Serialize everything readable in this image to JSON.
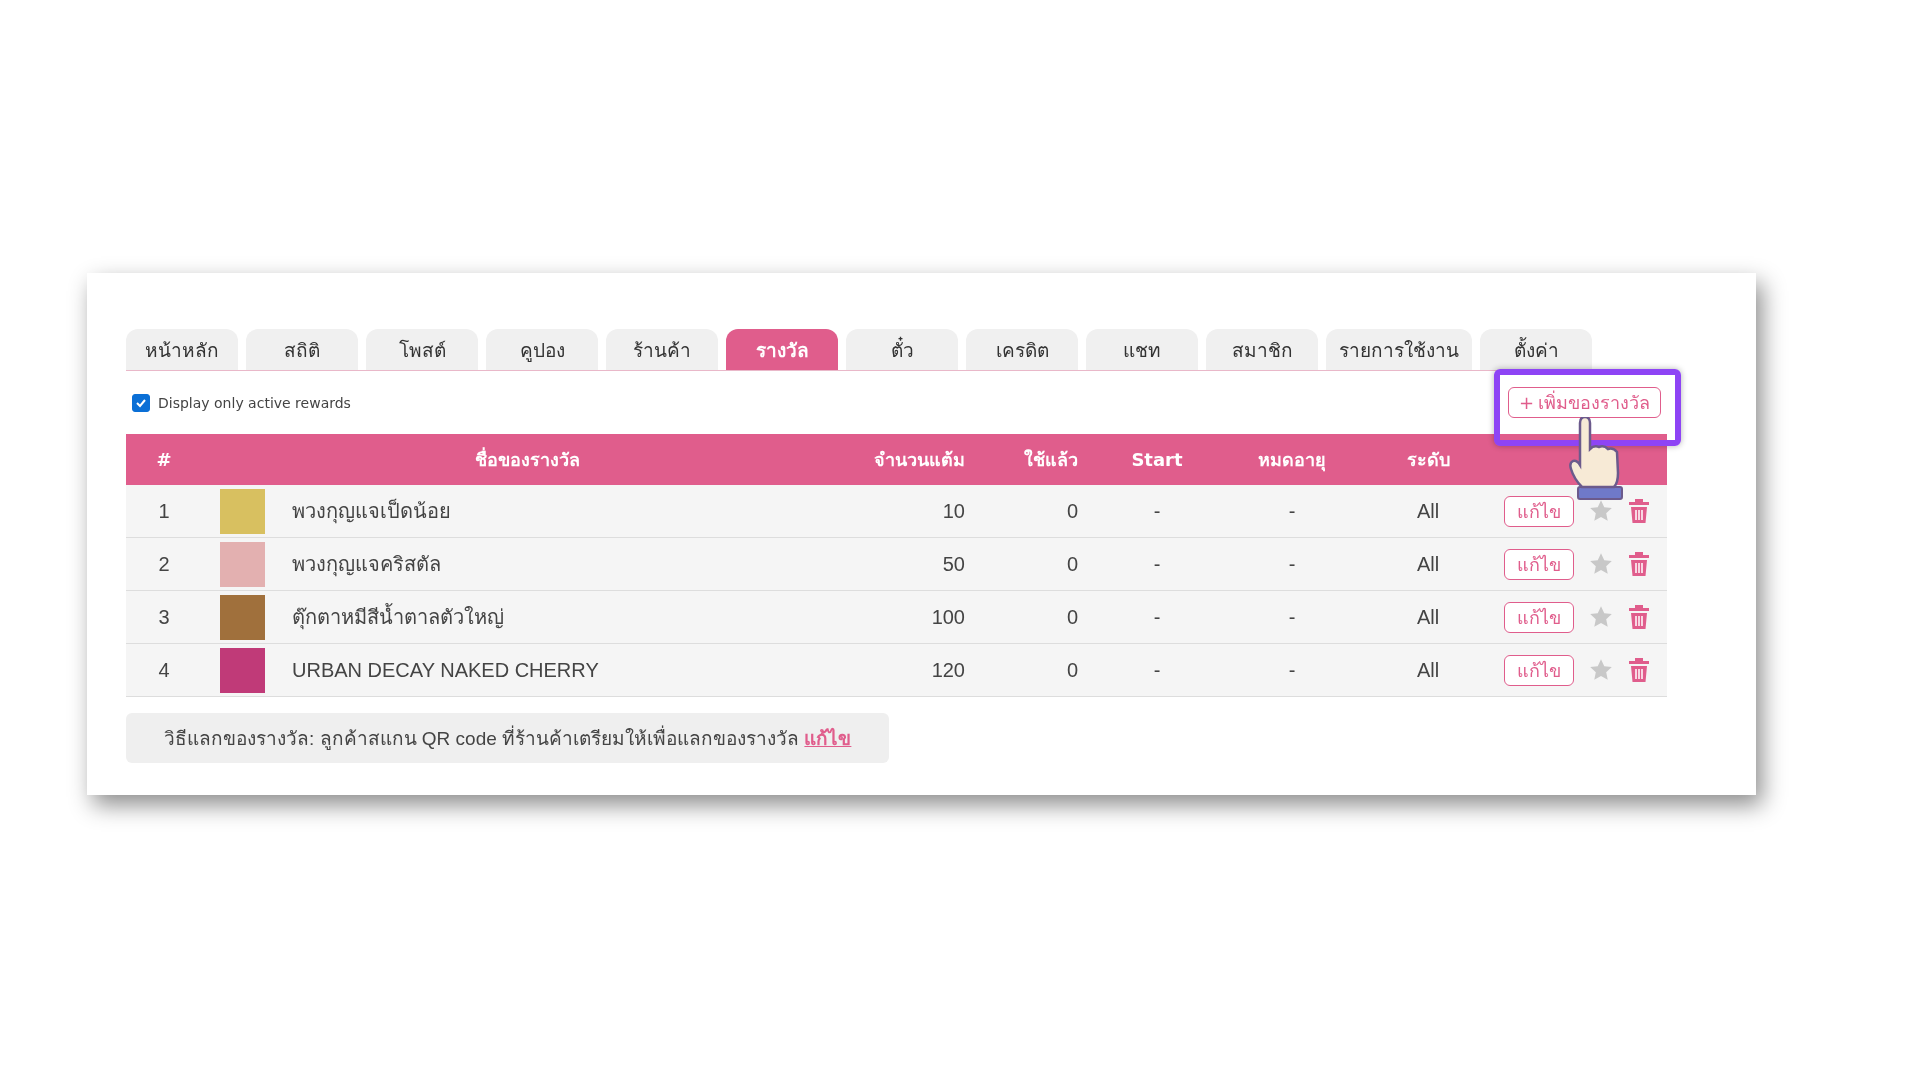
{
  "tabs": [
    {
      "label": "หน้าหลัก",
      "selected": false
    },
    {
      "label": "สถิติ",
      "selected": false
    },
    {
      "label": "โพสต์",
      "selected": false
    },
    {
      "label": "คูปอง",
      "selected": false
    },
    {
      "label": "ร้านค้า",
      "selected": false
    },
    {
      "label": "รางวัล",
      "selected": true
    },
    {
      "label": "ตั๋ว",
      "selected": false
    },
    {
      "label": "เครดิต",
      "selected": false
    },
    {
      "label": "แชท",
      "selected": false
    },
    {
      "label": "สมาชิก",
      "selected": false
    },
    {
      "label": "รายการใช้งาน",
      "selected": false
    },
    {
      "label": "ตั้งค่า",
      "selected": false
    }
  ],
  "filter": {
    "label": "Display only active rewards",
    "checked": true
  },
  "add_button": {
    "icon": "+",
    "label": "เพิ่มของรางวัล",
    "highlighted": true
  },
  "table": {
    "columns": [
      "#",
      "ชื่อของรางวัล",
      "จำนวนแต้ม",
      "ใช้แล้ว",
      "Start",
      "หมดอายุ",
      "ระดับ"
    ],
    "rows": [
      {
        "index": "1",
        "name": "พวงกุญแจเป็ดน้อย",
        "points": "10",
        "used": "0",
        "start": "-",
        "expiry": "-",
        "level": "All",
        "edit": "แก้ไข",
        "featured": false
      },
      {
        "index": "2",
        "name": "พวงกุญแจคริสตัล",
        "points": "50",
        "used": "0",
        "start": "-",
        "expiry": "-",
        "level": "All",
        "edit": "แก้ไข",
        "featured": false
      },
      {
        "index": "3",
        "name": "ตุ๊กตาหมีสีน้ำตาลตัวใหญ่",
        "points": "100",
        "used": "0",
        "start": "-",
        "expiry": "-",
        "level": "All",
        "edit": "แก้ไข",
        "featured": false
      },
      {
        "index": "4",
        "name": "URBAN DECAY NAKED CHERRY",
        "points": "120",
        "used": "0",
        "start": "-",
        "expiry": "-",
        "level": "All",
        "edit": "แก้ไข",
        "featured": false
      }
    ]
  },
  "note": {
    "text": "วิธีแลกของรางวัล: ลูกค้าสแกน QR code ที่ร้านค้าเตรียมให้เพื่อแลกของรางวัล",
    "link": "แก้ไข"
  }
}
